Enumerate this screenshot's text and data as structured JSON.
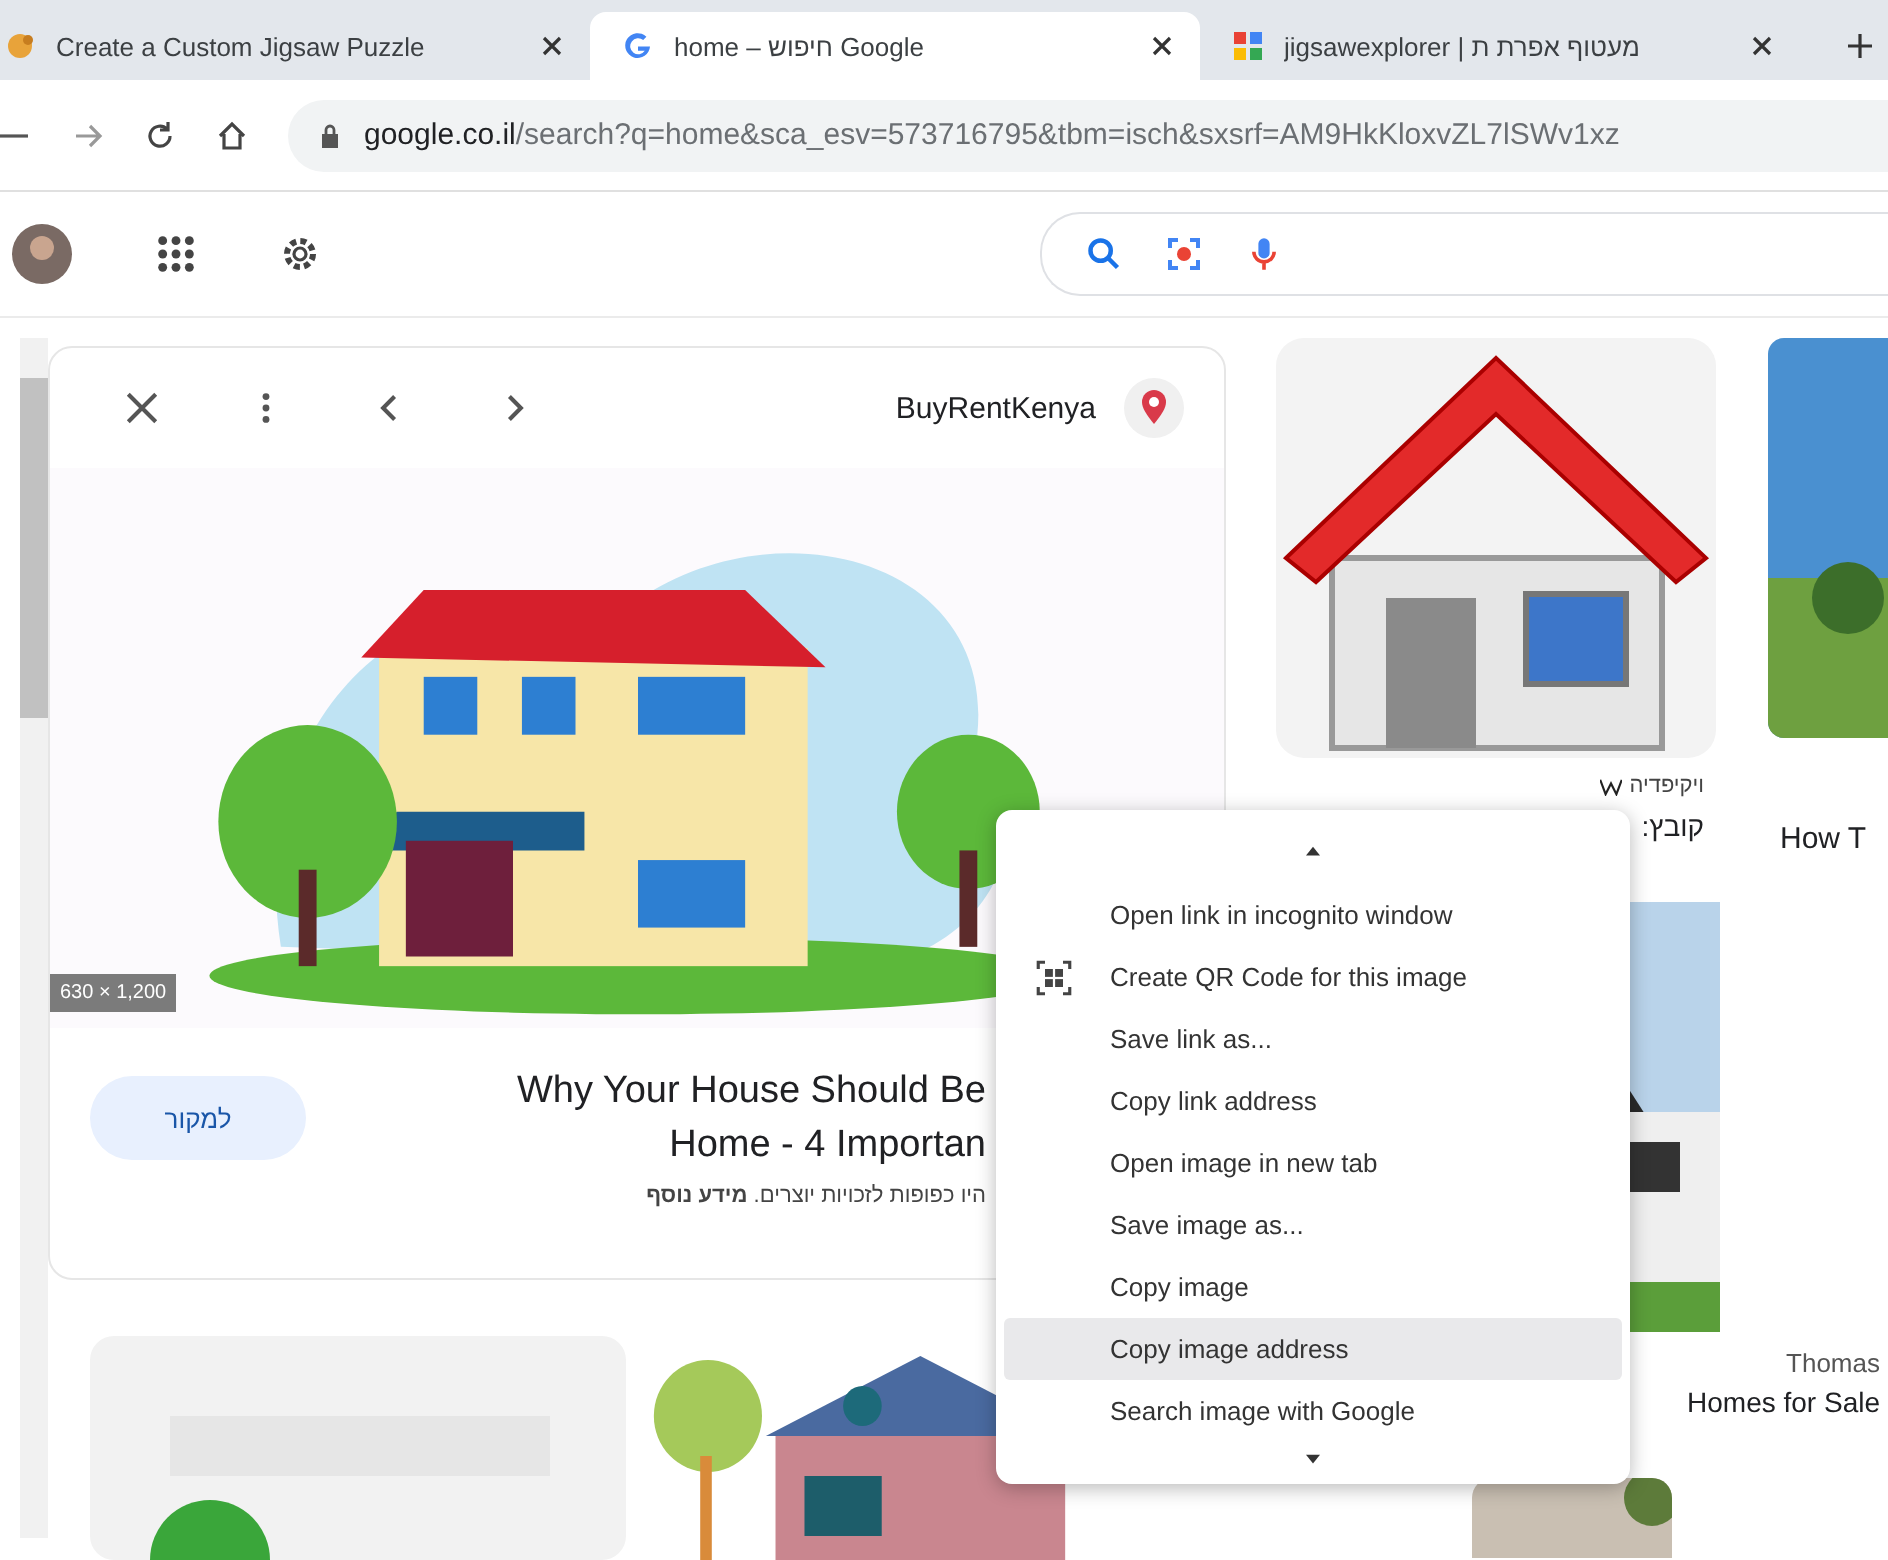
{
  "tabs": [
    {
      "title": "Create a Custom Jigsaw Puzzle",
      "selected": false
    },
    {
      "title": "home – חיפוש Google",
      "selected": true
    },
    {
      "title": "jigsawexplorer | מעטוף אפרת ת",
      "selected": false
    }
  ],
  "address": {
    "domain": "google.co.il",
    "path": "/search?q=home&sca_esv=573716795&tbm=isch&sxsrf=AM9HkKloxvZL7lSWv1xz"
  },
  "preview": {
    "source": "BuyRentKenya",
    "size": "630 × 1,200",
    "visit": "למקור",
    "title_lines": [
      "Why Your House Should Be",
      "Home - 4 Importan"
    ],
    "notice": "היו כפופות לזכויות יוצרים. **מידע נוסף**"
  },
  "results": [
    {
      "site": "ויקיפדיה",
      "title": "קובץ:"
    },
    {
      "title": "How T"
    },
    {
      "site": "Thomas",
      "title": "Homes for Sale"
    }
  ],
  "context_menu": {
    "items": [
      {
        "label": "Open link in incognito window",
        "kind": "plain",
        "selected": false
      },
      {
        "label": "Create QR Code for this image",
        "kind": "qr",
        "selected": false
      },
      {
        "label": "Save link as...",
        "kind": "plain",
        "selected": false
      },
      {
        "label": "Copy link address",
        "kind": "plain",
        "selected": false
      },
      {
        "label": "Open image in new tab",
        "kind": "plain",
        "selected": false
      },
      {
        "label": "Save image as...",
        "kind": "plain",
        "selected": false
      },
      {
        "label": "Copy image",
        "kind": "plain",
        "selected": false
      },
      {
        "label": "Copy image address",
        "kind": "plain",
        "selected": true
      },
      {
        "label": "Search image with Google",
        "kind": "plain",
        "selected": false
      }
    ]
  }
}
